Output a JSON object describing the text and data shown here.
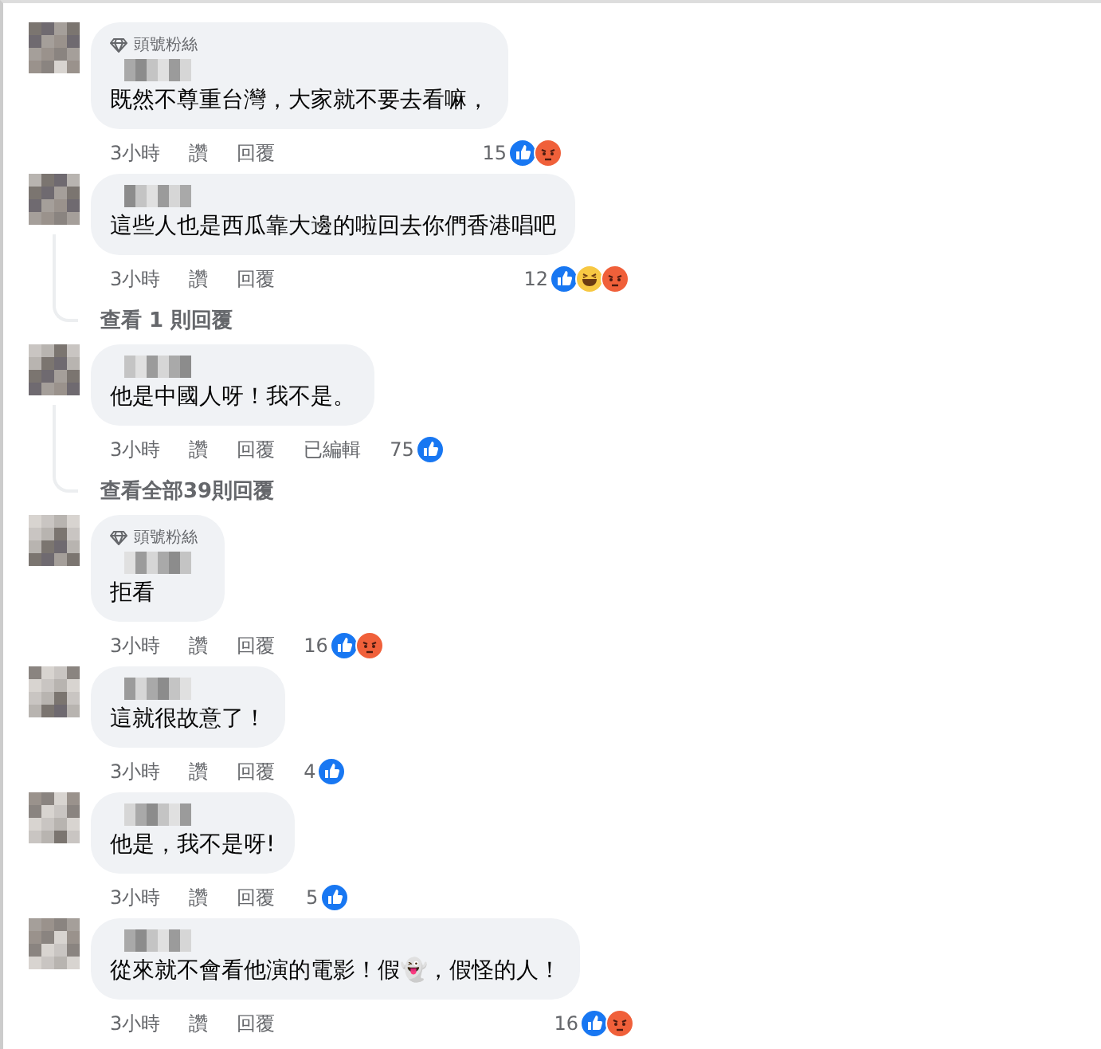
{
  "comments": [
    {
      "badge": "頭號粉絲",
      "text": "既然不尊重台灣，大家就不要去看嘛，",
      "time": "3小時",
      "like": "讚",
      "reply": "回覆",
      "count": "15",
      "reactions": [
        {
          "kind": "like"
        },
        {
          "kind": "angry"
        }
      ]
    },
    {
      "text": "這些人也是西瓜靠大邊的啦回去你們香港唱吧",
      "time": "3小時",
      "like": "讚",
      "reply": "回覆",
      "count": "12",
      "reactions": [
        {
          "kind": "like"
        },
        {
          "kind": "haha"
        },
        {
          "kind": "angry"
        }
      ],
      "more_replies": "查看 1 則回覆"
    },
    {
      "text": "他是中國人呀！我不是。",
      "time": "3小時",
      "like": "讚",
      "reply": "回覆",
      "edited": "已編輯",
      "count": "75",
      "reactions": [
        {
          "kind": "like"
        }
      ],
      "more_replies": "查看全部39則回覆"
    },
    {
      "badge": "頭號粉絲",
      "text": "拒看",
      "time": "3小時",
      "like": "讚",
      "reply": "回覆",
      "count": "16",
      "reactions": [
        {
          "kind": "like"
        },
        {
          "kind": "angry"
        }
      ]
    },
    {
      "text": "這就很故意了！",
      "time": "3小時",
      "like": "讚",
      "reply": "回覆",
      "count": "4",
      "reactions": [
        {
          "kind": "like"
        }
      ]
    },
    {
      "text": "他是，我不是呀!",
      "time": "3小時",
      "like": "讚",
      "reply": "回覆",
      "count": "5",
      "reactions": [
        {
          "kind": "like"
        }
      ]
    },
    {
      "text": "從來就不會看他演的電影！假👻，假怪的人！",
      "time": "3小時",
      "like": "讚",
      "reply": "回覆",
      "count": "16",
      "reactions": [
        {
          "kind": "like"
        },
        {
          "kind": "angry"
        }
      ]
    }
  ]
}
